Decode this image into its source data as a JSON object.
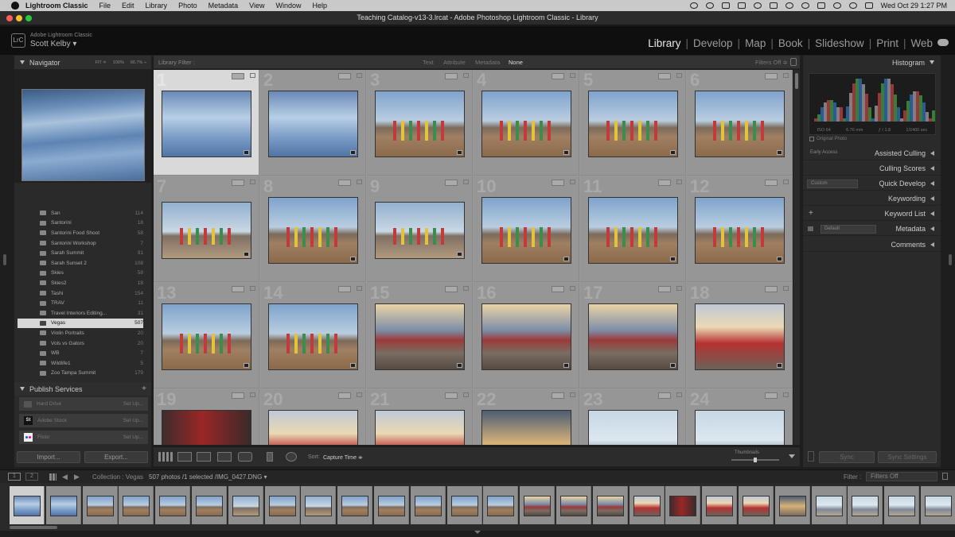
{
  "menubar": {
    "app": "Lightroom Classic",
    "items": [
      "File",
      "Edit",
      "Library",
      "Photo",
      "Metadata",
      "View",
      "Window",
      "Help"
    ],
    "clock": "Wed Oct 29  1:27 PM"
  },
  "window": {
    "title": "Teaching Catalog-v13-3.lrcat - Adobe Photoshop Lightroom Classic - Library"
  },
  "identity": {
    "logo": "LrC",
    "app_name": "Adobe Lightroom Classic",
    "user": "Scott Kelby ▾",
    "modules": [
      "Library",
      "Develop",
      "Map",
      "Book",
      "Slideshow",
      "Print",
      "Web"
    ],
    "active_module": "Library"
  },
  "left_panel": {
    "navigator": {
      "title": "Navigator",
      "zoom_options": [
        "FIT ≑",
        "100%",
        "66.7% ÷"
      ]
    },
    "collections": [
      {
        "name": "San",
        "count": "114"
      },
      {
        "name": "Santorini",
        "count": "18"
      },
      {
        "name": "Santorini Food Shoot",
        "count": "58"
      },
      {
        "name": "Santorini Workshop",
        "count": "7"
      },
      {
        "name": "Sarah Summit",
        "count": "91"
      },
      {
        "name": "Sarah Sunset 2",
        "count": "108"
      },
      {
        "name": "Skies",
        "count": "58"
      },
      {
        "name": "Skies2",
        "count": "18"
      },
      {
        "name": "Tashi",
        "count": "154"
      },
      {
        "name": "TRAV",
        "count": "11"
      },
      {
        "name": "Travel Interiors Editing...",
        "count": "31"
      },
      {
        "name": "Vegas",
        "count": "507",
        "selected": true
      },
      {
        "name": "Violin Portraits",
        "count": "20"
      },
      {
        "name": "Vols vs Gators",
        "count": "20"
      },
      {
        "name": "WB",
        "count": "7"
      },
      {
        "name": "Wildlife1",
        "count": "5"
      },
      {
        "name": "Zoo Tampa Summit",
        "count": "179"
      }
    ],
    "publish": {
      "title": "Publish Services",
      "services": [
        {
          "name": "Hard Drive",
          "action": "Set Up..."
        },
        {
          "name": "Adobe Stock",
          "action": "Set Up..."
        },
        {
          "name": "Flickr",
          "action": "Set Up..."
        }
      ]
    },
    "import_label": "Import...",
    "export_label": "Export..."
  },
  "filter_bar": {
    "title": "Library Filter :",
    "options": [
      "Text",
      "Attribute",
      "Metadata",
      "None"
    ],
    "active": "None",
    "filters_off": "Filters Off ≑"
  },
  "grid": {
    "cells": [
      {
        "num": "1",
        "style": "sky",
        "selected": true
      },
      {
        "num": "2",
        "style": "sky"
      },
      {
        "num": "3",
        "style": "desert"
      },
      {
        "num": "4",
        "style": "desert"
      },
      {
        "num": "5",
        "style": "desert"
      },
      {
        "num": "6",
        "style": "desert"
      },
      {
        "num": "7",
        "style": "desert2"
      },
      {
        "num": "8",
        "style": "desert"
      },
      {
        "num": "9",
        "style": "desert2"
      },
      {
        "num": "10",
        "style": "desert"
      },
      {
        "num": "11",
        "style": "desert"
      },
      {
        "num": "12",
        "style": "desert"
      },
      {
        "num": "13",
        "style": "desert"
      },
      {
        "num": "14",
        "style": "desert"
      },
      {
        "num": "15",
        "style": "car"
      },
      {
        "num": "16",
        "style": "car"
      },
      {
        "num": "17",
        "style": "car"
      },
      {
        "num": "18",
        "style": "car2"
      },
      {
        "num": "19",
        "style": "redrm"
      },
      {
        "num": "20",
        "style": "car2"
      },
      {
        "num": "21",
        "style": "car2"
      },
      {
        "num": "22",
        "style": "sunset"
      },
      {
        "num": "23",
        "style": "mtn"
      },
      {
        "num": "24",
        "style": "mtn"
      }
    ]
  },
  "toolbar": {
    "sort_label": "Sort:",
    "sort_value": "Capture Time ≑",
    "thumbnails_label": "Thumbnails"
  },
  "right_panel": {
    "histogram_title": "Histogram",
    "histogram_info": [
      "ISO 64",
      "6.76 mm",
      "ƒ / 1.8",
      "1/2400 sec"
    ],
    "original_photo": "Original Photo",
    "early_access": "Early Access",
    "sections": [
      {
        "title": "Assisted Culling"
      },
      {
        "title": "Culling Scores"
      },
      {
        "title": "Quick Develop",
        "control": "Custom"
      },
      {
        "title": "Keywording"
      },
      {
        "title": "Keyword List",
        "control": "+"
      },
      {
        "title": "Metadata",
        "control": "Default"
      },
      {
        "title": "Comments"
      }
    ],
    "sync_label": "Sync",
    "sync_settings_label": "Sync Settings"
  },
  "filmstrip": {
    "views": [
      "1",
      "2"
    ],
    "source": "Collection : Vegas",
    "count": "507 photos /1 selected /IMG_0427.DNG ▾",
    "filter_label": "Filter :",
    "filter_value": "Filters Off"
  },
  "colors": {
    "accent_selected": "#d9d9d9",
    "panel": "#2a2a2a",
    "grid_bg": "#999999"
  }
}
